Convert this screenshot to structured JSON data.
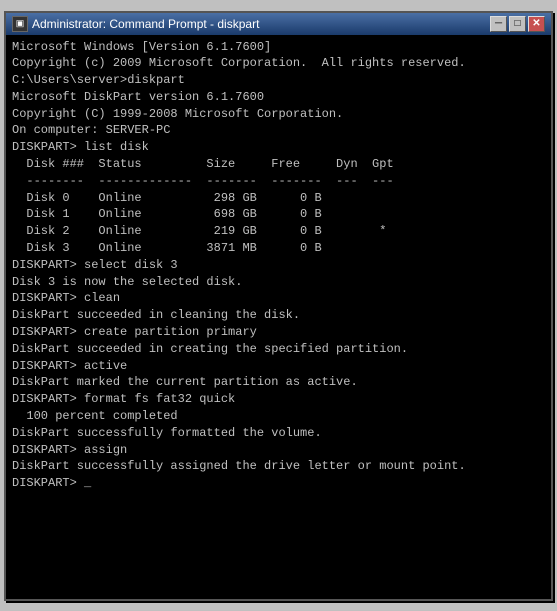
{
  "window": {
    "title": "Administrator: Command Prompt - diskpart",
    "title_icon": "▣"
  },
  "buttons": {
    "minimize": "─",
    "maximize": "□",
    "close": "✕"
  },
  "console_lines": [
    "Microsoft Windows [Version 6.1.7600]",
    "Copyright (c) 2009 Microsoft Corporation.  All rights reserved.",
    "",
    "C:\\Users\\server>diskpart",
    "",
    "Microsoft DiskPart version 6.1.7600",
    "Copyright (C) 1999-2008 Microsoft Corporation.",
    "On computer: SERVER-PC",
    "",
    "DISKPART> list disk",
    "",
    "  Disk ###  Status         Size     Free     Dyn  Gpt",
    "  --------  -------------  -------  -------  ---  ---",
    "  Disk 0    Online          298 GB      0 B",
    "  Disk 1    Online          698 GB      0 B",
    "  Disk 2    Online          219 GB      0 B        *",
    "  Disk 3    Online         3871 MB      0 B",
    "",
    "DISKPART> select disk 3",
    "",
    "Disk 3 is now the selected disk.",
    "",
    "DISKPART> clean",
    "",
    "DiskPart succeeded in cleaning the disk.",
    "",
    "DISKPART> create partition primary",
    "",
    "DiskPart succeeded in creating the specified partition.",
    "",
    "DISKPART> active",
    "",
    "DiskPart marked the current partition as active.",
    "",
    "DISKPART> format fs fat32 quick",
    "",
    "  100 percent completed",
    "",
    "DiskPart successfully formatted the volume.",
    "",
    "DISKPART> assign",
    "",
    "DiskPart successfully assigned the drive letter or mount point.",
    "",
    "DISKPART> _"
  ]
}
